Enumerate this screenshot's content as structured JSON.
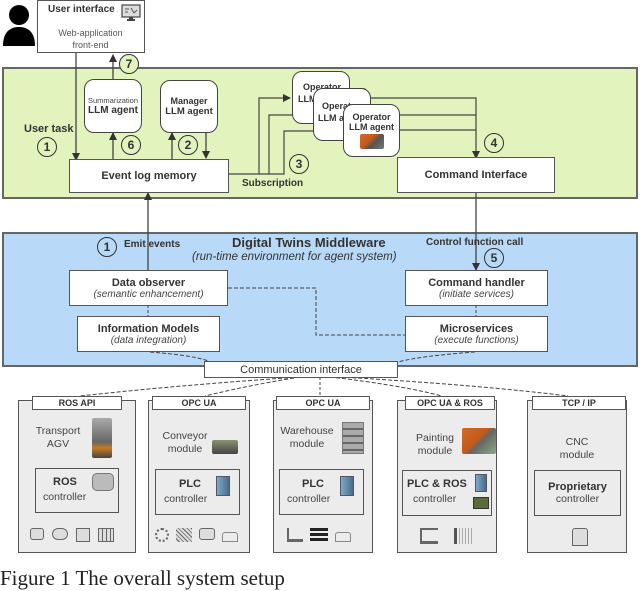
{
  "user_interface": {
    "title": "User interface",
    "subtitle_line1": "Web-application",
    "subtitle_line2": "front-end"
  },
  "agent_layer": {
    "user_task_label": "User task",
    "steps": [
      "1",
      "2",
      "3",
      "4",
      "6",
      "7"
    ],
    "summarization_agent": {
      "line1": "Summarization",
      "line2": "LLM agent"
    },
    "manager_agent": {
      "line1": "Manager",
      "line2": "LLM agent"
    },
    "operator_agent_back": {
      "line1": "Operator",
      "line2": "LLM agent"
    },
    "operator_agent_mid": {
      "line1": "Operator",
      "line2": "LLM agent"
    },
    "operator_agent_front": {
      "line1": "Operator",
      "line2": "LLM agent"
    },
    "event_log_memory": "Event log memory",
    "subscription_label": "Subscription",
    "command_interface": "Command Interface"
  },
  "middleware": {
    "title": "Digital Twins Middleware",
    "subtitle": "(run-time environment for agent system)",
    "emit_events_step": "1",
    "emit_events_label": "Emit events",
    "control_call_label": "Control function call",
    "control_call_step": "5",
    "data_observer": {
      "title": "Data observer",
      "subtitle": "(semantic enhancement)"
    },
    "information_models": {
      "title": "Information Models",
      "subtitle": "(data integration)"
    },
    "command_handler": {
      "title": "Command handler",
      "subtitle": "(initiate services)"
    },
    "microservices": {
      "title": "Microservices",
      "subtitle": "(execute functions)"
    },
    "communication_interface": "Communication interface"
  },
  "modules": [
    {
      "protocol": "ROS API",
      "name_line1": "Transport",
      "name_line2": "AGV",
      "controller_line1": "ROS",
      "controller_line2": "controller",
      "device_icons": [
        "motor-icon",
        "valve-icon",
        "sensor-icon",
        "solar-panel-icon"
      ]
    },
    {
      "protocol": "OPC UA",
      "name_line1": "Conveyor",
      "name_line2": "module",
      "controller_line1": "PLC",
      "controller_line2": "controller",
      "device_icons": [
        "gears-icon",
        "conveyor-icon",
        "motor-icon",
        "wireless-sensor-icon"
      ]
    },
    {
      "protocol": "OPC UA",
      "name_line1": "Warehouse",
      "name_line2": "module",
      "controller_line1": "PLC",
      "controller_line2": "controller",
      "device_icons": [
        "robot-arm-icon",
        "shelf-icon",
        "wireless-sensor-icon"
      ]
    },
    {
      "protocol": "OPC UA & ROS",
      "name_line1": "Painting",
      "name_line2": "module",
      "controller_line1": "PLC & ROS",
      "controller_line2": "controller",
      "device_icons": [
        "robot-arm-icon",
        "spray-nozzle-icon"
      ]
    },
    {
      "protocol": "TCP / IP",
      "name_line1": "CNC",
      "name_line2": "module",
      "controller_line1": "Proprietary",
      "controller_line2": "controller",
      "device_icons": [
        "valve-actuator-icon"
      ]
    }
  ],
  "caption": "Figure 1 The overall system setup"
}
